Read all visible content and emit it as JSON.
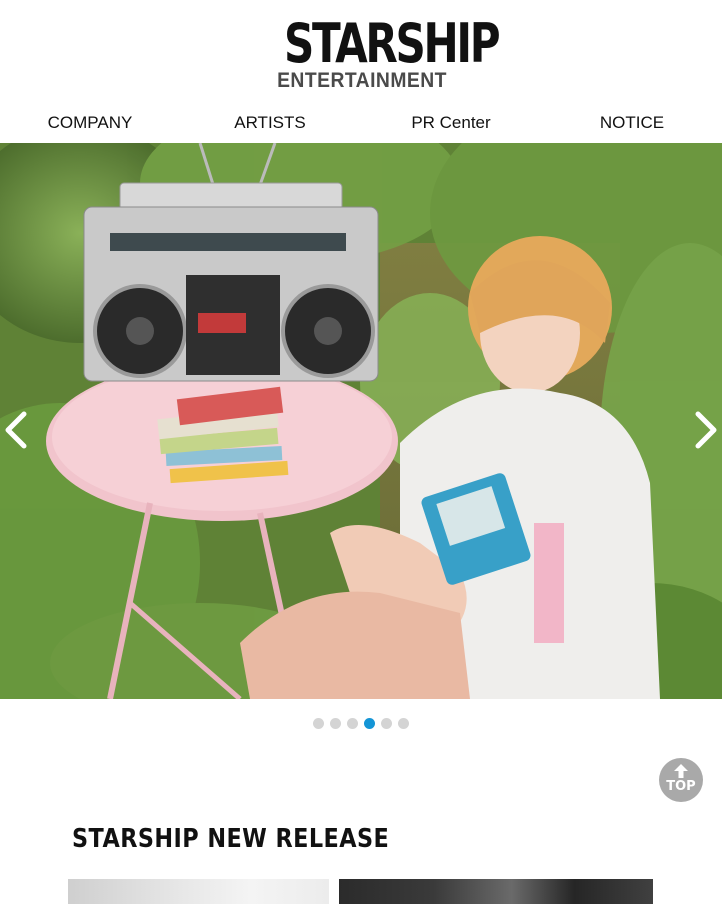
{
  "header": {
    "logo_main": "STARSHIP",
    "logo_sub": "ENTERTAINMENT"
  },
  "nav": {
    "items": [
      {
        "label": "COMPANY"
      },
      {
        "label": "ARTISTS"
      },
      {
        "label": "PR Center"
      },
      {
        "label": "NOTICE"
      }
    ]
  },
  "hero": {
    "icons": {
      "prev": "chevron-left-icon",
      "next": "chevron-right-icon"
    },
    "slide_count": 6,
    "active_slide": 4
  },
  "top_button": {
    "label": "TOP",
    "icon": "arrow-up-icon"
  },
  "new_release": {
    "title": "STARSHIP NEW RELEASE"
  },
  "colors": {
    "active_dot": "#1495d6",
    "inactive_dot": "#d4d4d4",
    "top_button_bg": "#a9a9a9",
    "logo_sub": "#4a4a4a"
  }
}
